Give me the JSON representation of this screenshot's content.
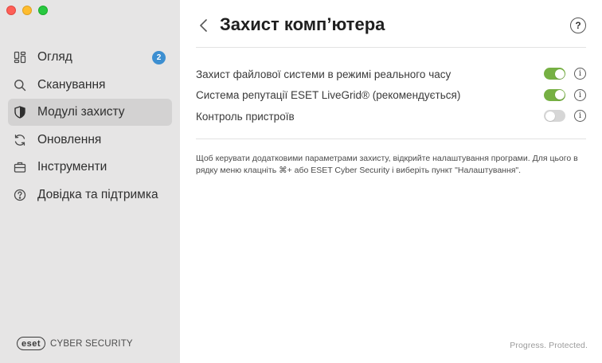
{
  "sidebar": {
    "items": [
      {
        "label": "Огляд",
        "icon": "overview-icon",
        "badge": "2",
        "active": false
      },
      {
        "label": "Сканування",
        "icon": "search-icon",
        "active": false
      },
      {
        "label": "Модулі захисту",
        "icon": "shield-icon",
        "active": true
      },
      {
        "label": "Оновлення",
        "icon": "refresh-icon",
        "active": false
      },
      {
        "label": "Інструменти",
        "icon": "toolbox-icon",
        "active": false
      },
      {
        "label": "Довідка та підтримка",
        "icon": "help-circle-icon",
        "active": false
      }
    ],
    "brand": {
      "logo_text": "eset",
      "product_text": "CYBER SECURITY"
    }
  },
  "header": {
    "title": "Захист комп’ютера",
    "help_label": "?"
  },
  "settings": [
    {
      "label": "Захист файлової системи в режимі реального часу",
      "enabled": true
    },
    {
      "label": "Система репутації ESET LiveGrid® (рекомендується)",
      "enabled": true
    },
    {
      "label": "Контроль пристроїв",
      "enabled": false
    }
  ],
  "note": "Щоб керувати додатковими параметрами захисту, відкрийте налаштування програми. Для цього в рядку меню клацніть ⌘+ або ESET Cyber Security і виберіть пункт \"Налаштування\".",
  "footer": {
    "tagline": "Progress. Protected."
  },
  "colors": {
    "accent_green": "#76b043",
    "badge_blue": "#3d8fd1",
    "sidebar_bg": "#e6e5e5",
    "active_item_bg": "#d3d2d2"
  }
}
